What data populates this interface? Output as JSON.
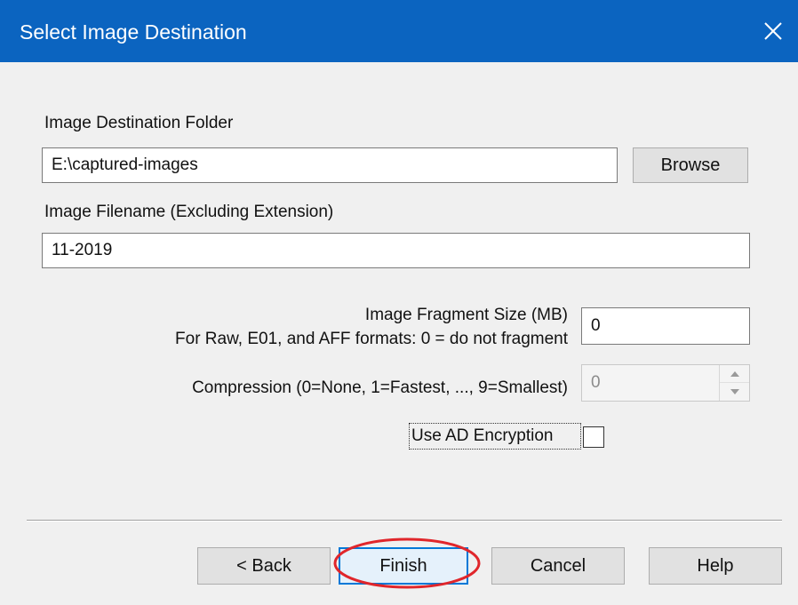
{
  "window": {
    "title": "Select Image Destination"
  },
  "destination_folder": {
    "label": "Image Destination Folder",
    "value": "E:\\captured-images",
    "browse_label": "Browse"
  },
  "filename": {
    "label": "Image Filename (Excluding Extension)",
    "value": "11-2019"
  },
  "fragment_size": {
    "label_line1": "Image Fragment Size (MB)",
    "label_line2": "For Raw, E01, and AFF formats: 0 = do not fragment",
    "value": "0"
  },
  "compression": {
    "label": "Compression (0=None, 1=Fastest, ..., 9=Smallest)",
    "value": "0"
  },
  "encryption": {
    "label": "Use AD Encryption",
    "checked": false
  },
  "buttons": {
    "back": "< Back",
    "finish": "Finish",
    "cancel": "Cancel",
    "help": "Help"
  },
  "colors": {
    "titlebar": "#0b64c0",
    "highlight": "#e0262b",
    "focus": "#0078d7"
  },
  "icons": {
    "close": "close-icon",
    "spin_up": "chevron-up-icon",
    "spin_down": "chevron-down-icon"
  }
}
